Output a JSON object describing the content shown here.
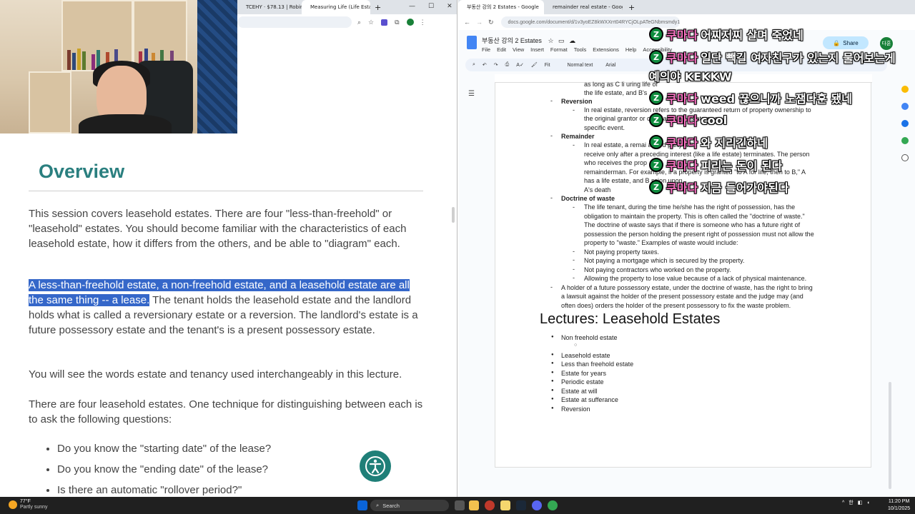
{
  "left_browser": {
    "tabs": [
      {
        "label": "TCEHY · $78.13 | Robinho",
        "active": false
      },
      {
        "label": "Measuring Life (Life Estat",
        "active": true
      }
    ],
    "window_controls": [
      "—",
      "☐",
      "✕"
    ]
  },
  "lesson": {
    "title": "Overview",
    "para1": "This session covers leasehold estates. There are four \"less-than-freehold\" or \"leasehold\" estates. You should become familiar with the characteristics of each leasehold estate, how it differs from the others, and be able to \"diagram\" each.",
    "para2_highlight": "A less-than-freehold estate, a non-freehold estate, and a leasehold estate are all the same thing -- a lease.",
    "para2_rest": " The tenant holds the leasehold estate and the landlord holds what is called a reversionary estate or a reversion. The landlord's estate is a future possessory estate and the tenant's is a present possessory estate.",
    "para3": "You will see the words estate and tenancy used interchangeably in this lecture.",
    "para4": "There are four leasehold estates. One technique for distinguishing between each is to ask the following questions:",
    "bullets": [
      "Do you know the \"starting date\" of the lease?",
      "Do you know the \"ending date\" of the lease?",
      "Is there an automatic \"rollover period?\""
    ]
  },
  "right_browser": {
    "tabs": [
      {
        "label": "부동산 강의 2 Estates - Google",
        "active": true
      },
      {
        "label": "remainder real estate - Google",
        "active": false
      }
    ],
    "url": "docs.google.com/document/d/1v3yoEZ8kWXXrrt04RYCjOLpATeGNbmsmdy1ncfwsTE/edit?tab=t.0",
    "doc_title": "부동산 강의 2 Estates",
    "menu": [
      "File",
      "Edit",
      "View",
      "Insert",
      "Format",
      "Tools",
      "Extensions",
      "Help",
      "Accessibility"
    ],
    "share_label": "Share",
    "avatar_initial": "다훈",
    "toolbar": {
      "zoom": "Fit",
      "style": "Normal text",
      "font": "Arial"
    }
  },
  "doc": {
    "top_fragment": "as long as C li                                                                    uring life of",
    "top_fragment2": "the life estate, and B's",
    "reversion_head": "Reversion",
    "reversion_body": [
      "In real estate, reversion refers to the guaranteed return of property ownership to",
      "the original grantor or                              on of a lesser estate or a",
      "specific event."
    ],
    "remainder_head": "Remainder",
    "remainder_body": [
      "In real estate, a remai                                        a third party will",
      "receive only after a preceding interest (like a life estate) terminates. The person",
      "who receives the prop",
      "remainderman. For example, if a property is granted \"to A for life, then to B,\" A",
      "has a life estate, and B                                          ssion upon",
      "A's death"
    ],
    "waste_head": "Doctrine of waste",
    "waste_body": [
      "The life tenant, during the time he/she has the right of possession, has the",
      "obligation to maintain the property. This is often called the \"doctrine of waste.\"",
      "The doctrine of waste says that if there is someone who has a future right of",
      "possession the person holding the present right of possession must not allow the",
      "property to \"waste.\" Examples of waste would include:"
    ],
    "waste_examples": [
      "Not paying property taxes.",
      "Not paying a mortgage which is secured by the property.",
      "Not paying contractors who worked on the property.",
      "Allowing the property to lose value because of a lack of physical maintenance."
    ],
    "holder_note": [
      "A holder of a future possessory estate, under the doctrine of waste, has the right to bring",
      "a lawsuit against the holder of the present possessory estate and the judge may (and",
      "often does) orders the holder of the present possessory to fix the waste problem."
    ],
    "lectures_heading": "Lectures: Leasehold Estates",
    "lectures": [
      "Non freehold estate",
      "",
      "Leasehold estate",
      "Less than freehold estate",
      "Estate for years",
      "Periodic estate",
      "Estate at will",
      "Estate at sufferance",
      "Reversion"
    ]
  },
  "chat": [
    {
      "user": "쿠마다",
      "msg": "어찌저찌 살며 죽었네"
    },
    {
      "user": "쿠마다",
      "msg": "일단 빽길 여자친구가 있는지 물어보는게"
    },
    {
      "user": "",
      "msg": "예의야 KEKKW"
    },
    {
      "user": "쿠마다",
      "msg": "weed 끊으니까 노잼다훈 됐네"
    },
    {
      "user": "쿠마다",
      "msg": "cool"
    },
    {
      "user": "쿠마다",
      "msg": "와 지리긴하네"
    },
    {
      "user": "쿠마다",
      "msg": "피리는 돈이 된다"
    },
    {
      "user": "쿠마다",
      "msg": "지금 들어가야된다"
    }
  ],
  "taskbar": {
    "temp": "77°F",
    "weather": "Partly sunny",
    "search": "Search",
    "time": "11:20 PM",
    "date": "10/1/2025",
    "ime": "한"
  },
  "colors": {
    "accent_teal": "#2a7f7f",
    "highlight": "#3567c9",
    "docs_blue": "#4285f4"
  }
}
